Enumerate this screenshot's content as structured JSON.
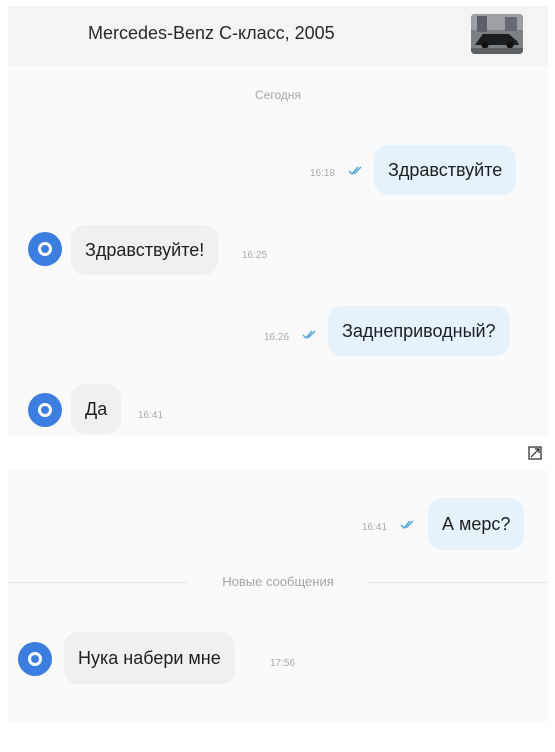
{
  "header": {
    "title": "Mercedes-Benz C-класс, 2005",
    "thumbnail_icon": "car-photo-thumbnail"
  },
  "separators": {
    "today": "Сегодня",
    "new_messages": "Новые сообщения"
  },
  "messages": [
    {
      "direction": "outgoing",
      "text": "Здравствуйте",
      "time": "16:18",
      "status": "read"
    },
    {
      "direction": "incoming",
      "text": "Здравствуйте!",
      "time": "16:25"
    },
    {
      "direction": "outgoing",
      "text": "Заднеприводный?",
      "time": "16:26",
      "status": "read"
    },
    {
      "direction": "incoming",
      "text": "Да",
      "time": "16:41"
    },
    {
      "direction": "outgoing",
      "text": "А мерс?",
      "time": "16:41",
      "status": "read"
    },
    {
      "direction": "incoming",
      "text": "Нука набери мне",
      "time": "17:56"
    }
  ],
  "colors": {
    "outgoing_bubble": "#e5f1fb",
    "incoming_bubble": "#f0f0f0",
    "avatar": "#3c7de0",
    "read_ticks": "#4aa6d8"
  },
  "icons": {
    "avatar": "avatar-ring-icon",
    "read_status": "double-check-icon",
    "expand": "expand-image-icon"
  }
}
